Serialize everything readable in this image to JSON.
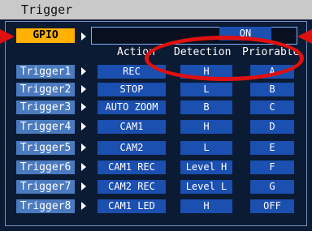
{
  "title": "Trigger",
  "gpio": {
    "label": "GPIO",
    "value": "ON"
  },
  "columns": [
    "Action",
    "Detection",
    "Priorable"
  ],
  "rows": [
    {
      "name": "Trigger1",
      "action": "REC",
      "detection": "H",
      "priority": "A"
    },
    {
      "name": "Trigger2",
      "action": "STOP",
      "detection": "L",
      "priority": "B"
    },
    {
      "name": "Trigger3",
      "action": "AUTO ZOOM",
      "detection": "B",
      "priority": "C"
    },
    {
      "name": "Trigger4",
      "action": "CAM1",
      "detection": "H",
      "priority": "D"
    },
    {
      "name": "Trigger5",
      "action": "CAM2",
      "detection": "L",
      "priority": "E"
    },
    {
      "name": "Trigger6",
      "action": "CAM1 REC",
      "detection": "Level H",
      "priority": "F"
    },
    {
      "name": "Trigger7",
      "action": "CAM2 REC",
      "detection": "Level L",
      "priority": "G"
    },
    {
      "name": "Trigger8",
      "action": "CAM1 LED",
      "detection": "H",
      "priority": "OFF"
    }
  ],
  "colors": {
    "background": "#0b1b33",
    "titlebar": "#c9c9c9",
    "selected_button": "#ffb000",
    "trigger_button": "#4a7ac0",
    "value_cell": "#1b4fb0",
    "annotation": "#e01010"
  }
}
